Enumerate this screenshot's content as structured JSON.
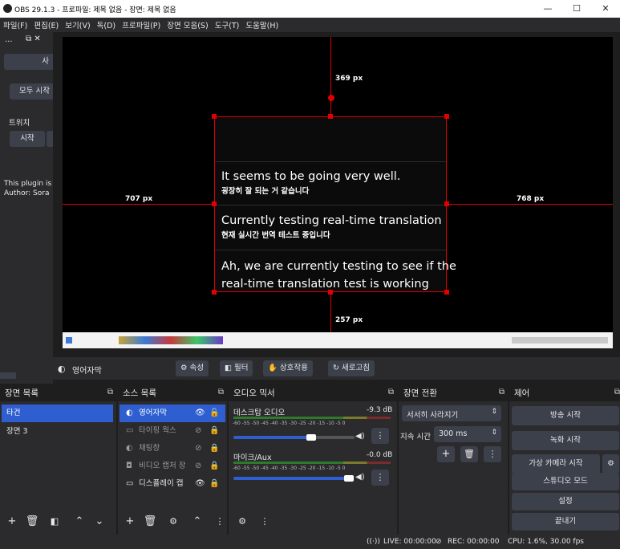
{
  "window": {
    "title": "OBS 29.1.3 - 프로파일: 제목 없음 - 장면: 제목 없음",
    "controls": [
      "—",
      "☐",
      "✕"
    ]
  },
  "menu": [
    "파일(F)",
    "편집(E)",
    "보기(V)",
    "독(D)",
    "프로파일(P)",
    "장면 모음(S)",
    "도구(T)",
    "도움말(H)"
  ],
  "left_dock": {
    "header": "...",
    "btn1": "사",
    "btn2": "모두 시작",
    "section": "트위치",
    "btn3": "시작",
    "plugin_text": "This plugin is",
    "author_text": "Author: Sora"
  },
  "preview": {
    "guide_top": "369 px",
    "guide_left": "707 px",
    "guide_right": "768 px",
    "guide_bottom": "257 px",
    "lines": [
      {
        "en": "It seems to be going very well.",
        "ko": "굉장히 잘 되는 거 같습니다"
      },
      {
        "en": "Currently testing real-time translation",
        "ko": "현재 실시간 번역 테스트 중입니다"
      },
      {
        "en": "Ah, we are currently testing to see if the",
        "en2": "real-time translation test is working"
      }
    ]
  },
  "source_bar": {
    "source_name": "영어자막",
    "props": "속성",
    "filters": "필터",
    "interact": "상호작용",
    "refresh": "새로고침"
  },
  "scenes": {
    "title": "장면 목록",
    "items": [
      "타건",
      "장면 3"
    ]
  },
  "sources": {
    "title": "소스 목록",
    "items": [
      "영어자막",
      "타이핑 웍스",
      "채팅창",
      "비디오 캡처 장",
      "디스플레이 캡"
    ]
  },
  "mixer": {
    "title": "오디오 믹서",
    "channels": [
      {
        "name": "데스크탑 오디오",
        "db": "-9.3 dB",
        "level": 0.45
      },
      {
        "name": "마이크/Aux",
        "db": "-0.0 dB",
        "level": 1.0
      }
    ],
    "scale": "-60 -55 -50 -45 -40 -35 -30 -25 -20 -15 -10 -5 0"
  },
  "transitions": {
    "title": "장면 전환",
    "type": "서서히 사라지기",
    "duration_label": "지속 시간",
    "duration": "300 ms"
  },
  "controls": {
    "title": "제어",
    "buttons": [
      "방송 시작",
      "녹화 시작",
      "가상 카메라 시작",
      "스튜디오 모드",
      "설정",
      "끝내기"
    ]
  },
  "status": {
    "live": "LIVE: 00:00:00",
    "rec": "REC: 00:00:00",
    "cpu": "CPU: 1.6%, 30.00 fps"
  },
  "colors": {
    "accent": "#2e5ed0",
    "guide": "#e00000",
    "panel": "#2b2a2c",
    "bg": "#1f1e1f"
  }
}
